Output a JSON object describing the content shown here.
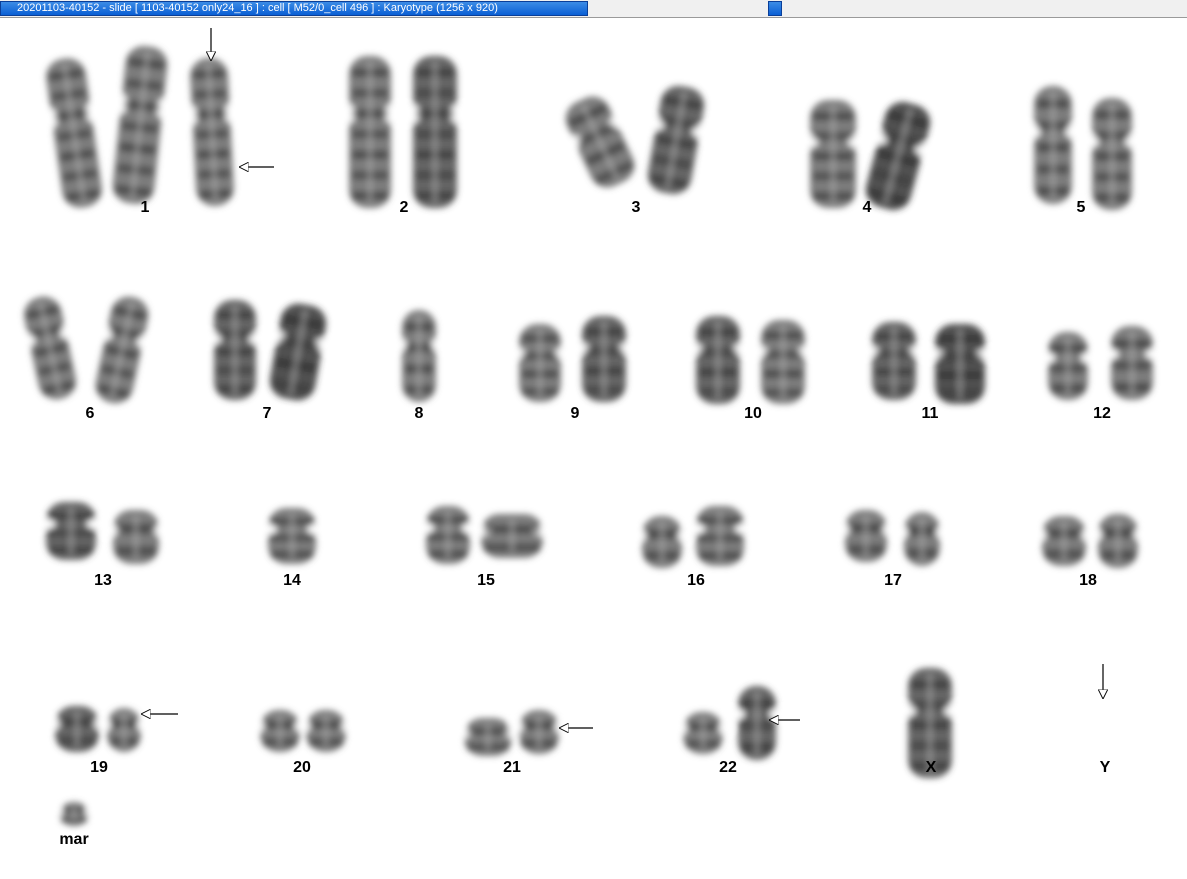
{
  "window": {
    "title": "20201103-40152 - slide [ 1103-40152 only24_16 ] : cell [ M52/0_cell 496 ] : Karyotype  (1256 x 920)"
  },
  "karyotype": {
    "labels": {
      "c1": "1",
      "c2": "2",
      "c3": "3",
      "c4": "4",
      "c5": "5",
      "c6": "6",
      "c7": "7",
      "c8": "8",
      "c9": "9",
      "c10": "10",
      "c11": "11",
      "c12": "12",
      "c13": "13",
      "c14": "14",
      "c15": "15",
      "c16": "16",
      "c17": "17",
      "c18": "18",
      "c19": "19",
      "c20": "20",
      "c21": "21",
      "c22": "22",
      "cX": "X",
      "cY": "Y",
      "mar": "mar"
    },
    "abnormality_arrows": [
      "1",
      "1",
      "19",
      "21",
      "22",
      "Y"
    ],
    "colors": {
      "chromosome": "#555555",
      "band_dark": "#333333",
      "background": "#ffffff",
      "title_bar": "#0a5fd4"
    }
  }
}
